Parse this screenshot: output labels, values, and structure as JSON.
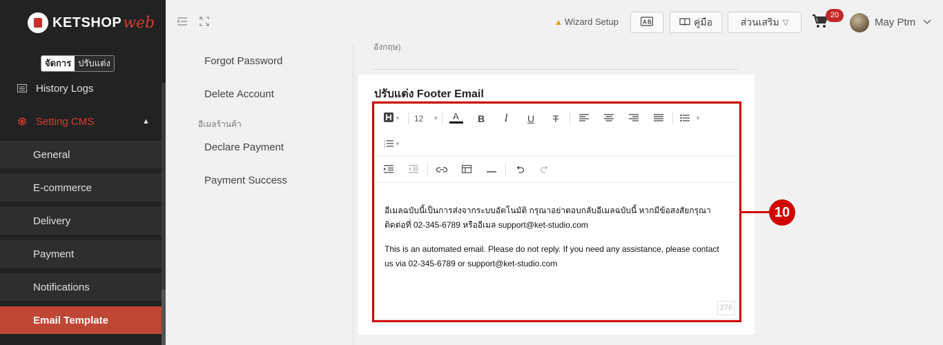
{
  "brand": {
    "name": "KETSHOP",
    "suffix": "web"
  },
  "mode_toggle": {
    "active": "จัดการ",
    "inactive": "ปรับแต่ง"
  },
  "sidebar": {
    "history_logs": "History Logs",
    "setting_cms": "Setting CMS",
    "sub_items": [
      "General",
      "E-commerce",
      "Delivery",
      "Payment",
      "Notifications",
      "Email Template"
    ],
    "active_item": "Email Template"
  },
  "topbar": {
    "wizard": "Wizard Setup",
    "manual": "คู่มือ",
    "addons": "ส่วนเสริม",
    "cart_count": "20",
    "user_name": "May Ptm"
  },
  "left_menu": {
    "forgot_password": "Forgot Password",
    "delete_account": "Delete Account",
    "shop_email_heading": "อีเมลร้านค้า",
    "declare_payment": "Declare Payment",
    "payment_success": "Payment Success"
  },
  "previous_field_label": "อังกฤษ)",
  "section": {
    "title": "ปรับแต่ง Footer Email"
  },
  "editor": {
    "font_size": "12",
    "paragraph_th": "อีเมลฉบับนี้เป็นการส่งจากระบบอัตโนมัติ กรุณาอย่าตอบกลับอีเมลฉบับนี้ หากมีข้อสงสัยกรุณาติดต่อที่ 02-345-6789 หรืออีเมล support@ket-studio.com",
    "paragraph_en": "This is an automated email. Please do not reply. If you need any assistance, please contact us via 02-345-6789 or support@ket-studio.com",
    "char_count": "276"
  },
  "annotation": {
    "number": "10",
    "color": "#d00000"
  },
  "colors": {
    "sidebar_bg": "#222222",
    "accent": "#d9392f",
    "active_item_bg": "#bf4634"
  }
}
